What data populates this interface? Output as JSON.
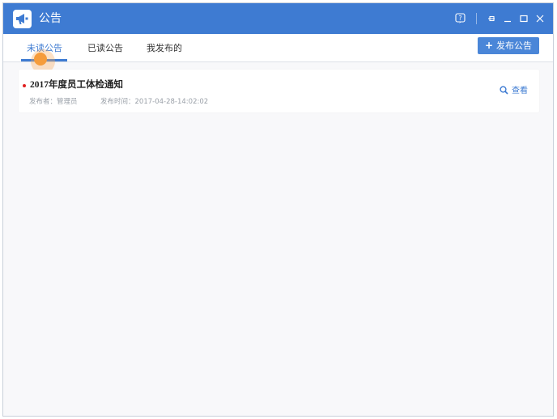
{
  "window": {
    "title": "公告",
    "accent_color": "#3e7bd2",
    "icons": [
      "megaphone-icon",
      "help-icon",
      "pin-icon",
      "minimize-icon",
      "maximize-icon",
      "close-icon"
    ]
  },
  "tabs": [
    {
      "label": "未读公告",
      "active": true
    },
    {
      "label": "已读公告",
      "active": false
    },
    {
      "label": "我发布的",
      "active": false
    }
  ],
  "toolbar": {
    "publish_label": "发布公告",
    "publish_icon": "+"
  },
  "notices": [
    {
      "title": "2017年度员工体检通知",
      "unread": true,
      "publisher_label": "发布者：",
      "publisher": "管理员",
      "time_label": "发布时间：",
      "time": "2017-04-28-14:02:02",
      "view_label": "查看",
      "view_icon": "search-icon"
    }
  ]
}
